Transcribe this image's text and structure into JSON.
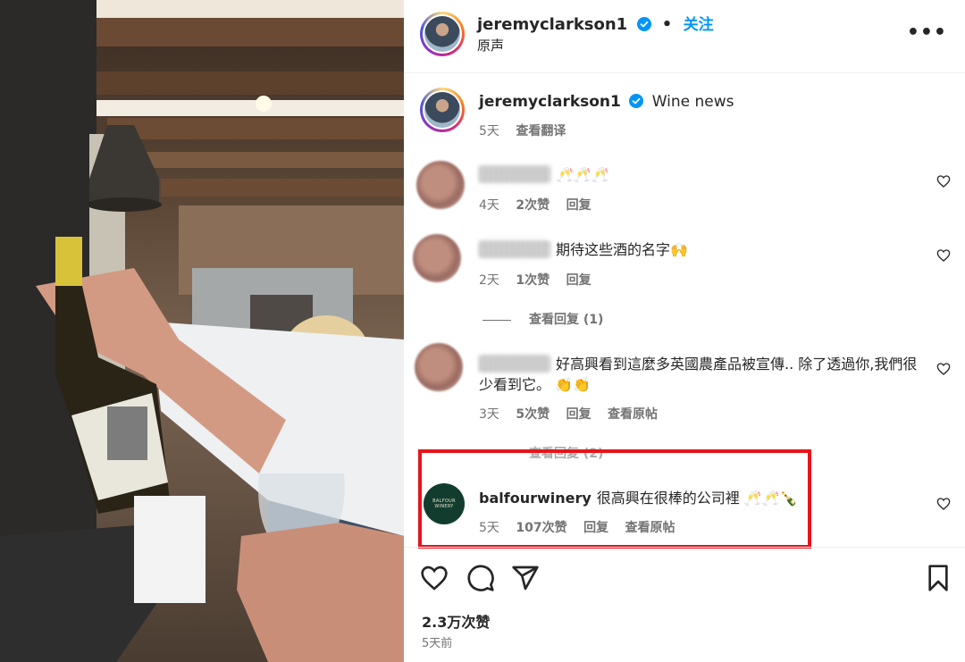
{
  "header": {
    "username": "jeremyclarkson1",
    "separator": "•",
    "follow_label": "关注",
    "subtitle": "原声",
    "more_label": "•••"
  },
  "caption": {
    "username": "jeremyclarkson1",
    "text": "Wine news",
    "time": "5天",
    "translate_label": "查看翻译"
  },
  "comments": [
    {
      "text": "🥂🥂🥂",
      "time": "4天",
      "likes": "2次赞",
      "reply_label": "回复"
    },
    {
      "text": "期待这些酒的名字🙌",
      "time": "2天",
      "likes": "1次赞",
      "reply_label": "回复",
      "view_replies": "查看回复 (1)"
    },
    {
      "text": "好高興看到這麼多英國農產品被宣傳.. 除了透過你,我們很少看到它。 👏👏",
      "time": "3天",
      "likes": "5次赞",
      "reply_label": "回复",
      "view_original": "查看原帖",
      "view_replies": "查看回复 (2)"
    },
    {
      "username": "balfourwinery",
      "text": "很高興在很棒的公司裡 🥂🥂🍾",
      "time": "5天",
      "likes": "107次赞",
      "reply_label": "回复",
      "view_original": "查看原帖",
      "avatar_text": "BALFOUR WINERY"
    }
  ],
  "footer": {
    "likes": "2.3万次赞",
    "posted": "5天前"
  },
  "colors": {
    "accent": "#0095f6",
    "highlight": "#e8131b",
    "muted": "#737373"
  },
  "icons": [
    "verified-badge-icon",
    "more-options-icon",
    "heart-icon",
    "comment-icon",
    "share-icon",
    "bookmark-icon"
  ]
}
